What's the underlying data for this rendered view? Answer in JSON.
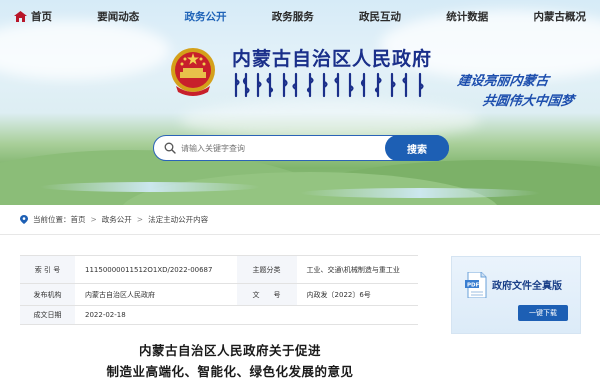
{
  "nav": {
    "items": [
      {
        "label": "首页",
        "icon": "home-icon"
      },
      {
        "label": "要闻动态"
      },
      {
        "label": "政务公开",
        "active": true
      },
      {
        "label": "政务服务"
      },
      {
        "label": "政民互动"
      },
      {
        "label": "统计数据"
      },
      {
        "label": "内蒙古概况"
      }
    ],
    "active_color": "#1f63b8"
  },
  "header": {
    "site_title": "内蒙古自治区人民政府",
    "slogan_line1": "建设亮丽内蒙古",
    "slogan_line2": "共圆伟大中国梦",
    "title_color": "#1a2f8a"
  },
  "search": {
    "placeholder": "请输入关键字查询",
    "button_label": "搜索",
    "accent": "#1d5fb4"
  },
  "breadcrumb": {
    "prefix": "当前位置：",
    "items": [
      "首页",
      "政务公开",
      "法定主动公开内容"
    ]
  },
  "meta": {
    "rows": [
      {
        "k1": "索 引 号",
        "v1": "11150000011512O1XD/2022-00687",
        "k2": "主题分类",
        "v2": "工业、交通\\机械制造与重工业"
      },
      {
        "k1": "发布机构",
        "v1": "内蒙古自治区人民政府",
        "k2": "文　　号",
        "v2": "内政发〔2022〕6号"
      },
      {
        "k1": "成文日期",
        "v1": "2022-02-18",
        "k2": "",
        "v2": ""
      }
    ]
  },
  "doc_card": {
    "title": "政府文件全真版",
    "button_label": "一键下载"
  },
  "document": {
    "title_line1": "内蒙古自治区人民政府关于促进",
    "title_line2": "制造业高端化、智能化、绿色化发展的意见"
  }
}
